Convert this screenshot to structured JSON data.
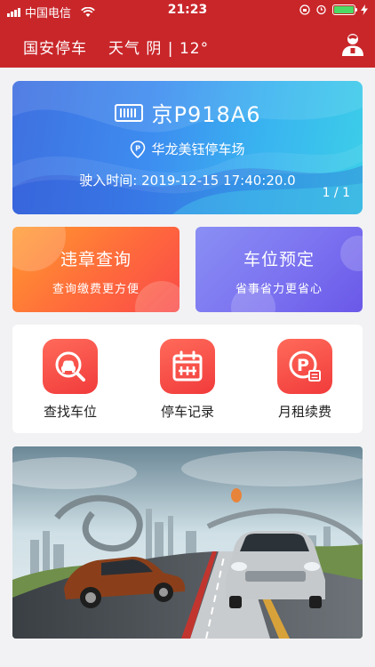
{
  "status_bar": {
    "carrier": "中国电信",
    "time": "21:23"
  },
  "header": {
    "title": "国安停车",
    "weather": "天气 阴 | 12°"
  },
  "parking_card": {
    "plate_number": "京P918A6",
    "lot_name": "华龙美钰停车场",
    "entry_time_label": "驶入时间:",
    "entry_time": "2019-12-15 17:40:20.0",
    "pager": "1 / 1"
  },
  "tiles": [
    {
      "title": "违章查询",
      "subtitle": "查询缴费更方便"
    },
    {
      "title": "车位预定",
      "subtitle": "省事省力更省心"
    }
  ],
  "actions": [
    {
      "label": "查找车位",
      "icon": "search-car-icon"
    },
    {
      "label": "停车记录",
      "icon": "calendar-icon"
    },
    {
      "label": "月租续费",
      "icon": "parking-card-icon"
    }
  ],
  "colors": {
    "brand_red": "#c9262a",
    "card_blue": "#3d8df0",
    "tile_orange": "#ff6a3c",
    "tile_purple": "#7b72f0",
    "icon_red": "#f13b3b"
  }
}
